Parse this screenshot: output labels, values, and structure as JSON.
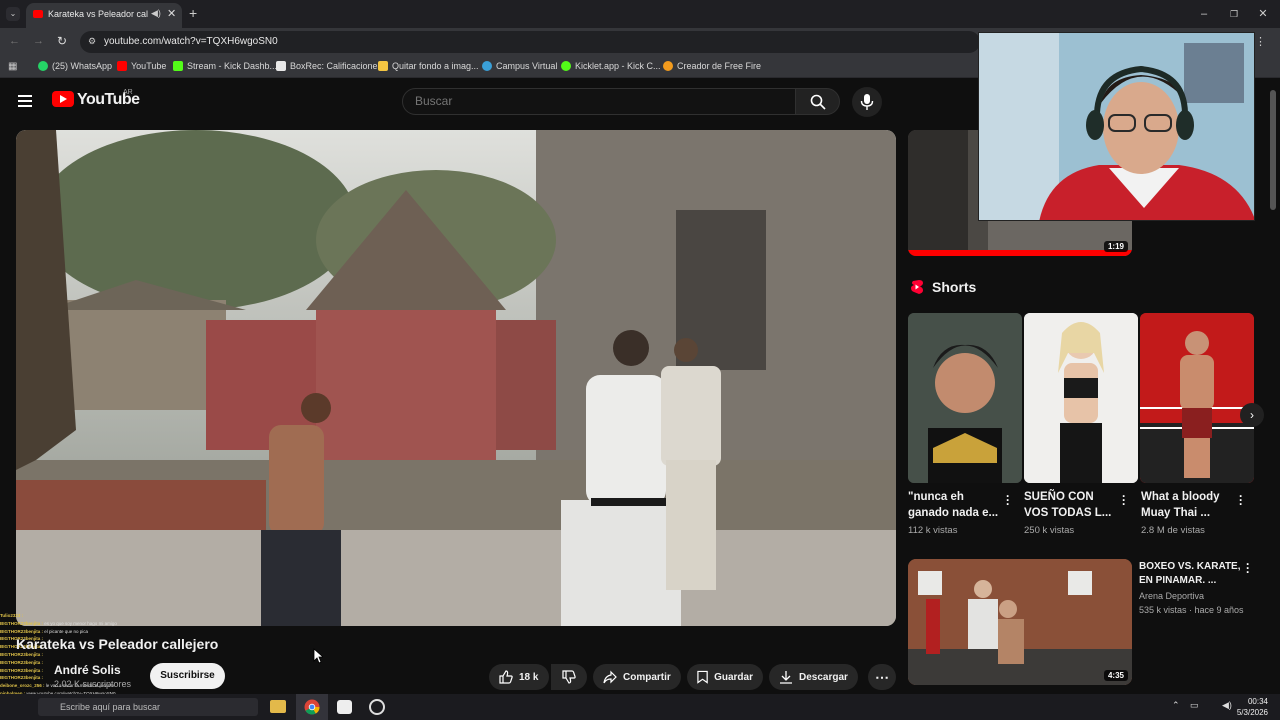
{
  "browser": {
    "tab_title": "Karateka vs Peleador callej",
    "url": "youtube.com/watch?v=TQXH6wgoSN0",
    "bookmarks": [
      {
        "label": "(25) WhatsApp",
        "color": "#25d366"
      },
      {
        "label": "YouTube",
        "color": "#ff0000"
      },
      {
        "label": "Stream - Kick Dashb...",
        "color": "#53fc18"
      },
      {
        "label": "BoxRec: Calificaciones",
        "color": "#e8e8e8"
      },
      {
        "label": "Quitar fondo a imag...",
        "color": "#f4c542"
      },
      {
        "label": "Campus Virtual",
        "color": "#3aa0d8"
      },
      {
        "label": "Kicklet.app - Kick C...",
        "color": "#53fc18"
      },
      {
        "label": "Creador de Free Fire",
        "color": "#f29b1d"
      }
    ]
  },
  "youtube": {
    "logo_text": "YouTube",
    "country": "AR",
    "search_placeholder": "Buscar"
  },
  "video": {
    "title": "Karateka vs Peleador callejero",
    "channel": "André Solis",
    "subscribers": "2.02 K suscriptores",
    "subscribe_label": "Suscribirse",
    "likes": "18 k",
    "share_label": "Compartir",
    "save_label": "Guardar",
    "download_label": "Descargar"
  },
  "sidebar": {
    "top_duration": "1:19",
    "shorts_title": "Shorts",
    "shorts": [
      {
        "title": "\"nunca eh ganado nada e...",
        "views": "112 k vistas"
      },
      {
        "title": "SUEÑO CON VOS TODAS L...",
        "views": "250 k vistas"
      },
      {
        "title": "What a bloody Muay Thai ...",
        "views": "2.8 M de vistas"
      }
    ],
    "recommended": {
      "title": "BOXEO VS. KARATE, EN PINAMAR. ...",
      "channel": "Arena Deportiva",
      "meta": "535 k vistas · hace 9 años",
      "duration": "4:35"
    }
  },
  "chat": [
    {
      "user": "Tulio2323 :",
      "msg": ""
    },
    {
      "user": "BIGTHOR23benjita :",
      "msg": "es yo que soy menor hago mi amigo"
    },
    {
      "user": "BIGTHOR23benjita :",
      "msg": "el picante que no pica"
    },
    {
      "user": "BIGTHOR23benjita :",
      "msg": ""
    },
    {
      "user": "BIGTHOR23benjita :",
      "msg": ""
    },
    {
      "user": "BIGTHOR23benjita :",
      "msg": ""
    },
    {
      "user": "BIGTHOR23benjita :",
      "msg": ""
    },
    {
      "user": "BIGTHOR23benjita :",
      "msg": ""
    },
    {
      "user": "BIGTHOR23benjita :",
      "msg": ""
    },
    {
      "user": "deibone_orozc_256 :",
      "msg": "le van a sacar la mierda al picante"
    },
    {
      "user": "pinbalmen :",
      "msg": "www.youtube.com/watch?v=TQXH6wgoSN0"
    },
    {
      "user": "BIGTHOR23benjita :",
      "msg": "https://www.youtube.com/watch?v=TQXH6wgoSN0"
    }
  ],
  "taskbar": {
    "search_placeholder": "Escribe aquí para buscar",
    "time": "00:34",
    "date": "5/3/2026"
  }
}
